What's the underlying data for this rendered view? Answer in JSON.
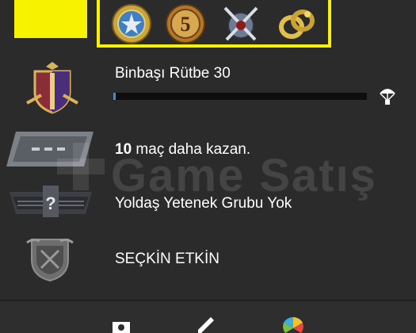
{
  "header": {
    "badges": [
      {
        "icon": "star-medal-icon"
      },
      {
        "icon": "five-coin-icon"
      },
      {
        "icon": "crossed-swords-icon"
      },
      {
        "icon": "gold-snake-icon"
      }
    ]
  },
  "rank": {
    "label": "Binbaşı Rütbe 30",
    "progress_percent": 1,
    "icon": "rank-shield-icon",
    "drop_icon": "parachute-icon"
  },
  "wins": {
    "count": "10",
    "text": " maç daha kazan."
  },
  "skill_group": {
    "label": "Yoldaş Yetenek Grubu Yok"
  },
  "activity": {
    "label": "SEÇKİN ETKİN"
  },
  "watermark": {
    "text": "Game Satış"
  },
  "colors": {
    "highlight": "#f7f300",
    "progress": "#3d8ed8",
    "background": "#2b2b2b"
  }
}
